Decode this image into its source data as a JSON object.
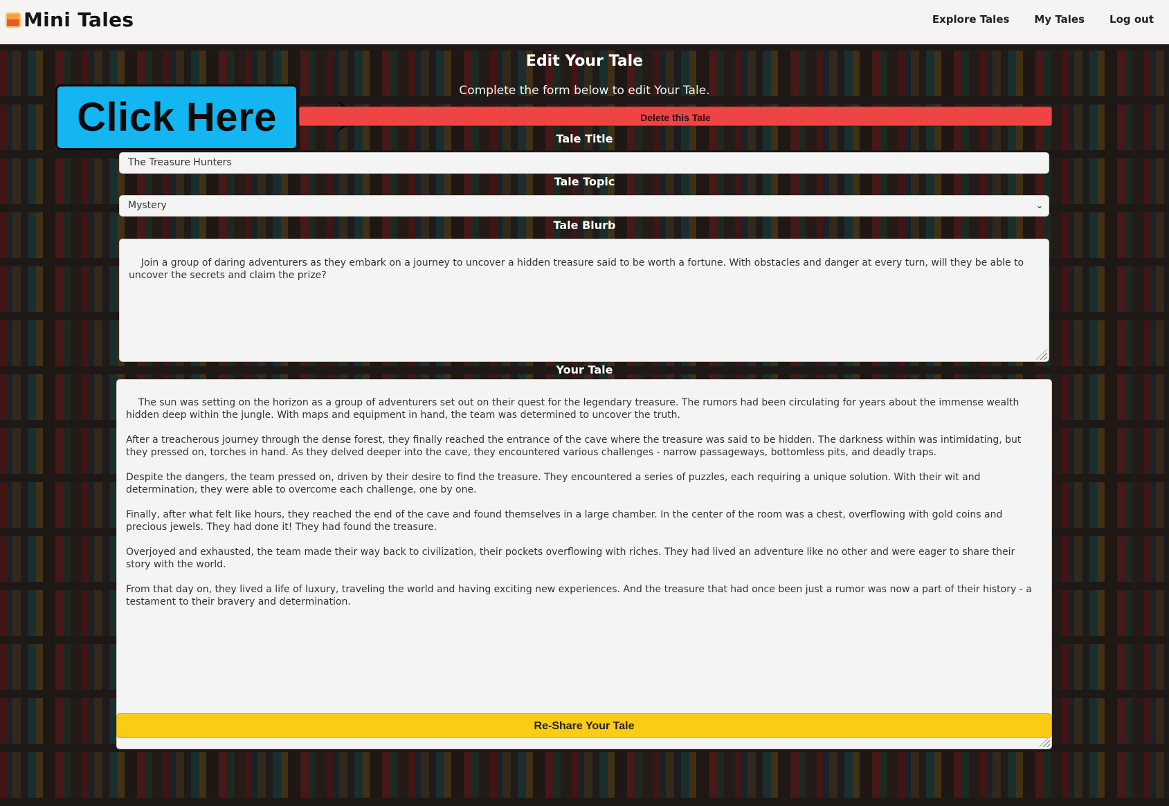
{
  "nav": {
    "brand": "Mini Tales",
    "links": [
      "Explore Tales",
      "My Tales",
      "Log out"
    ]
  },
  "page": {
    "title": "Edit Your Tale",
    "subtitle": "Complete the form below to edit Your Tale."
  },
  "callout": {
    "label": "Click Here",
    "color": "#13b6f0"
  },
  "delete_button": {
    "label": "Delete this Tale",
    "color": "#ef4444"
  },
  "form": {
    "title_label": "Tale Title",
    "title_value": "The Treasure Hunters",
    "topic_label": "Tale Topic",
    "topic_value": "Mystery",
    "blurb_label": "Tale Blurb",
    "blurb_value": "Join a group of daring adventurers as they embark on a journey to uncover a hidden treasure said to be worth a fortune. With obstacles and danger at every turn, will they be able to uncover the secrets and claim the prize?",
    "story_label": "Your Tale",
    "story_value": "The sun was setting on the horizon as a group of adventurers set out on their quest for the legendary treasure. The rumors had been circulating for years about the immense wealth hidden deep within the jungle. With maps and equipment in hand, the team was determined to uncover the truth.\n\nAfter a treacherous journey through the dense forest, they finally reached the entrance of the cave where the treasure was said to be hidden. The darkness within was intimidating, but they pressed on, torches in hand. As they delved deeper into the cave, they encountered various challenges - narrow passageways, bottomless pits, and deadly traps.\n\nDespite the dangers, the team pressed on, driven by their desire to find the treasure. They encountered a series of puzzles, each requiring a unique solution. With their wit and determination, they were able to overcome each challenge, one by one.\n\nFinally, after what felt like hours, they reached the end of the cave and found themselves in a large chamber. In the center of the room was a chest, overflowing with gold coins and precious jewels. They had done it! They had found the treasure.\n\nOverjoyed and exhausted, the team made their way back to civilization, their pockets overflowing with riches. They had lived an adventure like no other and were eager to share their story with the world.\n\nFrom that day on, they lived a life of luxury, traveling the world and having exciting new experiences. And the treasure that had once been just a rumor was now a part of their history - a testament to their bravery and determination."
  },
  "reshare_button": {
    "label": "Re-Share Your Tale",
    "color": "#facc15"
  },
  "icons": {
    "brand": "book-logo-icon",
    "select": "chevron-down-icon",
    "callout_arrow": "arrow-right-icon"
  }
}
